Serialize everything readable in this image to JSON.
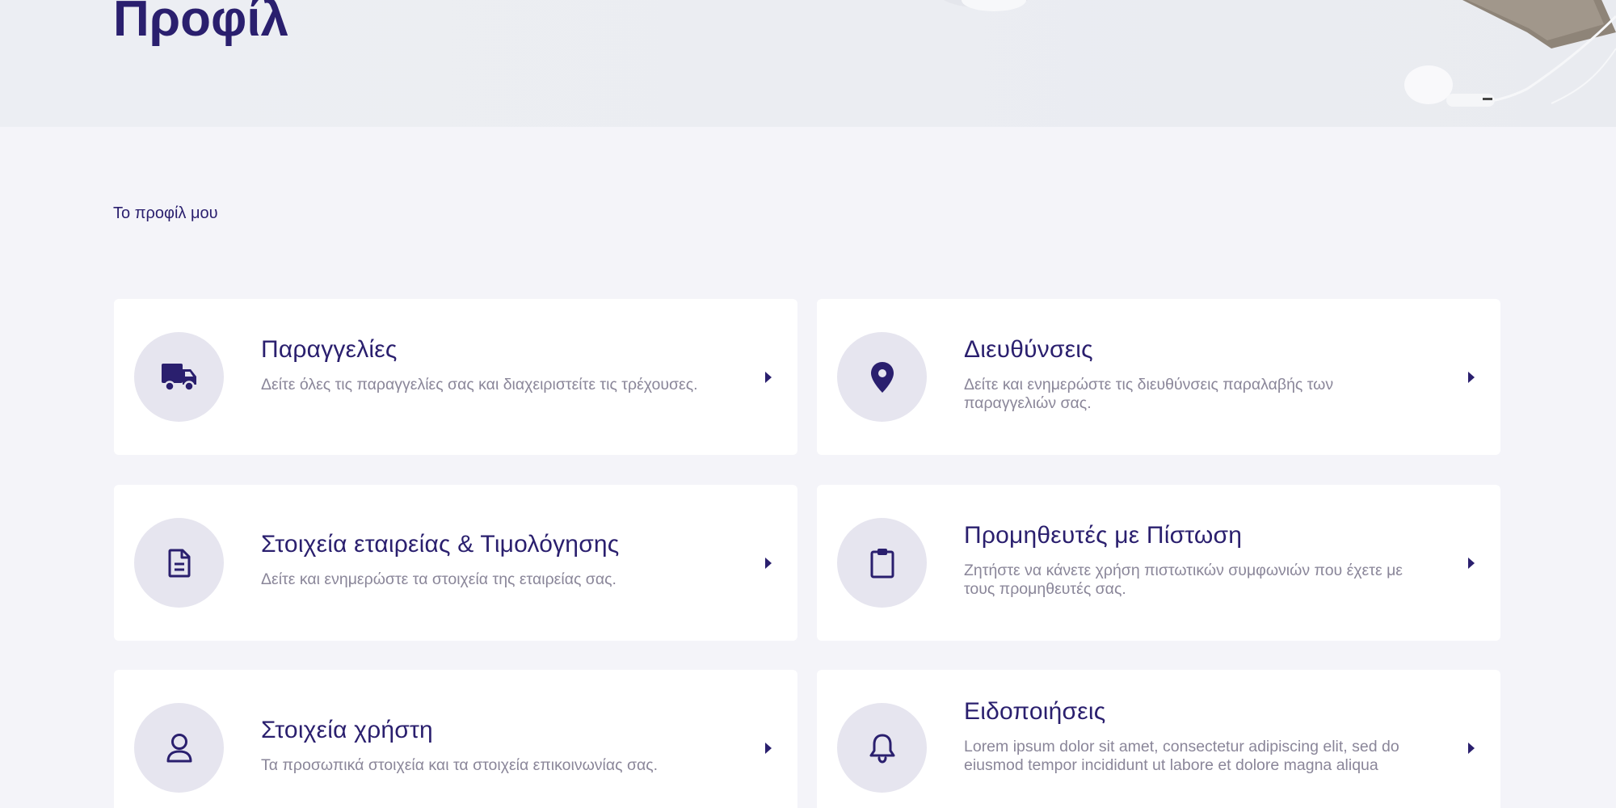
{
  "hero": {
    "title": "Προφίλ"
  },
  "breadcrumb": "Το προφίλ μου",
  "colors": {
    "primary": "#2a1f6e",
    "icon_bg": "#e6e5ef",
    "muted_text": "#8a8699",
    "page_bg": "#f4f4f9"
  },
  "cards": [
    {
      "title": "Παραγγελίες",
      "description": "Δείτε όλες τις παραγγελίες σας και διαχειριστείτε τις τρέχουσες.",
      "icon": "truck-icon"
    },
    {
      "title": "Διευθύνσεις",
      "description": "Δείτε και ενημερώστε τις διευθύνσεις παραλαβής των παραγγελιών σας.",
      "icon": "map-pin-icon"
    },
    {
      "title": "Στοιχεία εταιρείας & Τιμολόγησης",
      "description": "Δείτε και ενημερώστε τα στοιχεία της εταιρείας σας.",
      "icon": "document-icon"
    },
    {
      "title": "Προμηθευτές με Πίστωση",
      "description": "Ζητήστε να κάνετε χρήση πιστωτικών συμφωνιών που έχετε με τους προμηθευτές σας.",
      "icon": "clipboard-icon"
    },
    {
      "title": "Στοιχεία χρήστη",
      "description": "Τα προσωπικά στοιχεία και τα στοιχεία επικοινωνίας σας.",
      "icon": "user-icon"
    },
    {
      "title": "Ειδοποιήσεις",
      "description": "Lorem ipsum dolor sit amet, consectetur adipiscing elit, sed do eiusmod tempor incididunt ut labore et dolore magna aliqua",
      "icon": "bell-icon"
    }
  ]
}
